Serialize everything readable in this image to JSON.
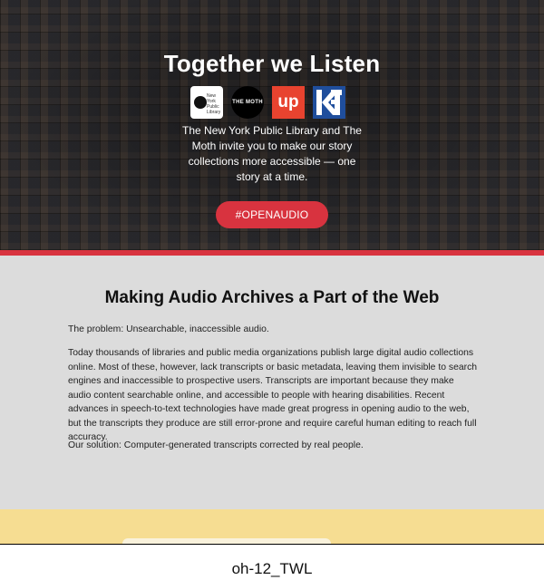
{
  "hero": {
    "title": "Together we Listen",
    "description": "The New York Public Library and The Moth invite you to make our story collections more accessible — one story at a time.",
    "cta_label": "#OPENAUDIO",
    "logos": {
      "nypl_text": "New York Public Library",
      "moth_text": "THE MOTH",
      "up_text": "up"
    }
  },
  "section": {
    "title": "Making Audio Archives a Part of the Web",
    "problem": "The problem: Unsearchable, inaccessible audio.",
    "body": "Today thousands of libraries and public media organizations publish large digital audio collections online. Most of these, however, lack transcripts or basic metadata, leaving them invisible to search engines and inaccessible to prospective users. Transcripts are important because they make audio content searchable online, and accessible to people with hearing disabilities. Recent advances in speech-to-text technologies have made great progress in opening audio to the web, but the transcripts they produce are still error-prone and require careful human editing to reach full accuracy.",
    "solution": "Our solution: Computer-generated transcripts corrected by real people."
  },
  "caption": "oh-12_TWL",
  "colors": {
    "accent_red": "#d8333f",
    "content_bg": "#dcdcdc",
    "footer_yellow": "#f6dd92"
  },
  "icons": [
    "nypl-logo-icon",
    "moth-logo-icon",
    "up-logo-icon",
    "kf-logo-icon",
    "skyline-icon"
  ]
}
